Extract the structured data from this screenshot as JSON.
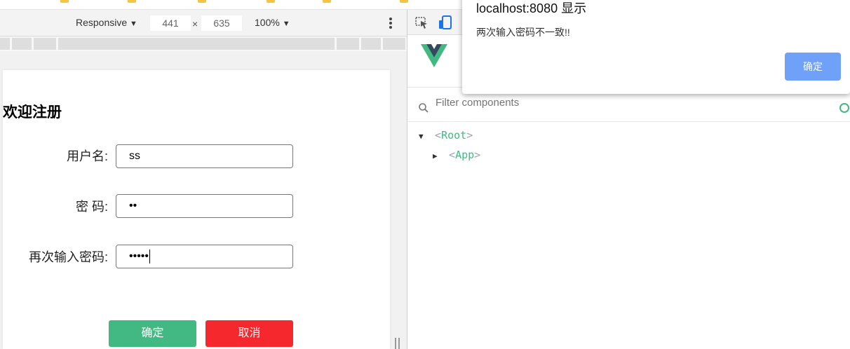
{
  "device_toolbar": {
    "mode": "Responsive",
    "width": "441",
    "times": "×",
    "height": "635",
    "zoom": "100%"
  },
  "page": {
    "title": "欢迎注册",
    "fields": [
      {
        "label": "用户名:",
        "value": "ss"
      },
      {
        "label": "密 码:",
        "value": "••"
      },
      {
        "label": "再次输入密码:",
        "value": "•••••"
      }
    ],
    "ok_label": "确定",
    "cancel_label": "取消"
  },
  "devtools": {
    "filter_placeholder": "Filter components",
    "tree": [
      {
        "open": "<",
        "name": "Root",
        "close": ">"
      },
      {
        "open": "<",
        "name": "App",
        "close": ">"
      }
    ]
  },
  "alert": {
    "title": "localhost:8080 显示",
    "message": "两次输入密码不一致!!",
    "ok_label": "确定"
  },
  "colors": {
    "vue_green": "#42b983",
    "cancel_red": "#f5282d",
    "alert_button_blue": "#6ea1f7"
  }
}
